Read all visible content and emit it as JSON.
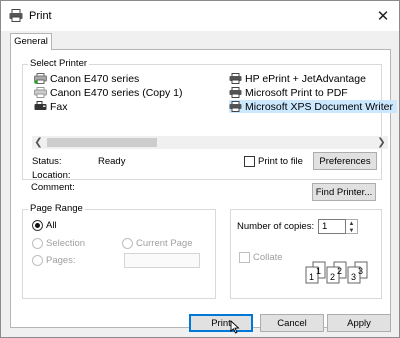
{
  "window": {
    "title": "Print",
    "close_glyph": "✕"
  },
  "tabs": [
    {
      "label": "General"
    }
  ],
  "select_printer": {
    "label": "Select Printer",
    "printers_left": [
      {
        "name": "Canon E470 series",
        "icon": "printer-icon"
      },
      {
        "name": "Canon E470 series (Copy 1)",
        "icon": "printer-icon"
      },
      {
        "name": "Fax",
        "icon": "fax-icon"
      }
    ],
    "printers_right": [
      {
        "name": "HP ePrint + JetAdvantage",
        "icon": "printer-icon"
      },
      {
        "name": "Microsoft Print to PDF",
        "icon": "printer-icon"
      },
      {
        "name": "Microsoft XPS Document Writer",
        "icon": "printer-icon",
        "selected": true
      }
    ],
    "status_label": "Status:",
    "status_value": "Ready",
    "location_label": "Location:",
    "comment_label": "Comment:",
    "print_to_file_label": "Print to file",
    "preferences_label": "Preferences",
    "find_printer_label": "Find Printer..."
  },
  "page_range": {
    "label": "Page Range",
    "all_label": "All",
    "selection_label": "Selection",
    "current_page_label": "Current Page",
    "pages_label": "Pages:",
    "pages_value": ""
  },
  "copies": {
    "label": "Number of copies:",
    "value": "1",
    "collate_label": "Collate",
    "collate_numbers": [
      "1",
      "1",
      "2",
      "2",
      "3",
      "3"
    ]
  },
  "buttons": {
    "print": "Print",
    "cancel": "Cancel",
    "apply": "Apply"
  },
  "colors": {
    "selected": "#cce8ff",
    "default_border": "#0078d7"
  }
}
